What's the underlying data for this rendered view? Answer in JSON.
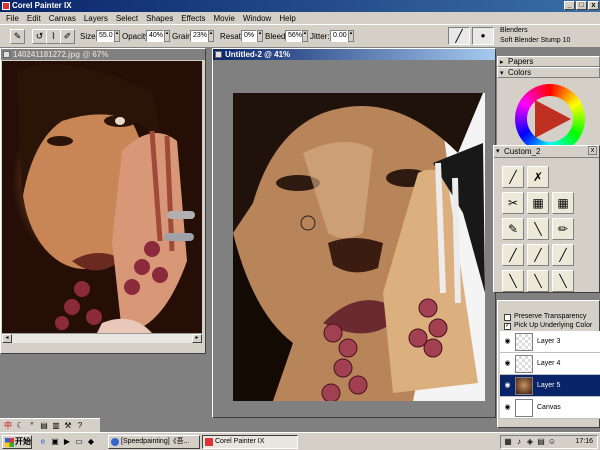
{
  "app": {
    "title": "Corel Painter IX",
    "window_controls": {
      "minimize": "_",
      "maximize": "□",
      "close": "x"
    }
  },
  "menu": [
    "File",
    "Edit",
    "Canvas",
    "Layers",
    "Select",
    "Shapes",
    "Effects",
    "Movie",
    "Window",
    "Help"
  ],
  "property_bar": {
    "size": {
      "label": "Size:",
      "value": "55.0"
    },
    "opacity": {
      "label": "Opacity:",
      "value": "40%"
    },
    "grain": {
      "label": "Grain:",
      "value": "23%"
    },
    "resat": {
      "label": "Resat:",
      "value": "0%"
    },
    "bleed": {
      "label": "Bleed:",
      "value": "56%"
    },
    "jitter": {
      "label": "Jitter:",
      "value": "0.00"
    }
  },
  "brush_selector": {
    "category": "Blenders",
    "variant": "Soft Blender Stump 10"
  },
  "documents": [
    {
      "title": "140241181272.jpg @ 67%"
    },
    {
      "title": "Untitled-2 @ 41%"
    }
  ],
  "palettes": {
    "papers": "Papers",
    "colors": "Colors",
    "custom": "Custom_2",
    "custom_close": "x"
  },
  "layers": {
    "preserve_transparency": {
      "label": "Preserve Transparency",
      "checked": false
    },
    "pick_up_underlying_color": {
      "label": "Pick Up Underlying Color",
      "checked": true
    },
    "items": [
      {
        "name": "Layer 3",
        "selected": false
      },
      {
        "name": "Layer 4",
        "selected": false
      },
      {
        "name": "Layer 5",
        "selected": true
      },
      {
        "name": "Canvas",
        "selected": false
      }
    ]
  },
  "taskbar": {
    "start": "开始",
    "tasks": [
      {
        "label": "[Speedpainting]《吾...",
        "active": false
      },
      {
        "label": "Corel Painter IX",
        "active": true
      }
    ],
    "clock": "17:16"
  },
  "colors": {
    "titlebar": "#0a246a",
    "chrome": "#d4d0c8",
    "workspace": "#808080",
    "selection": "#0a246a"
  }
}
